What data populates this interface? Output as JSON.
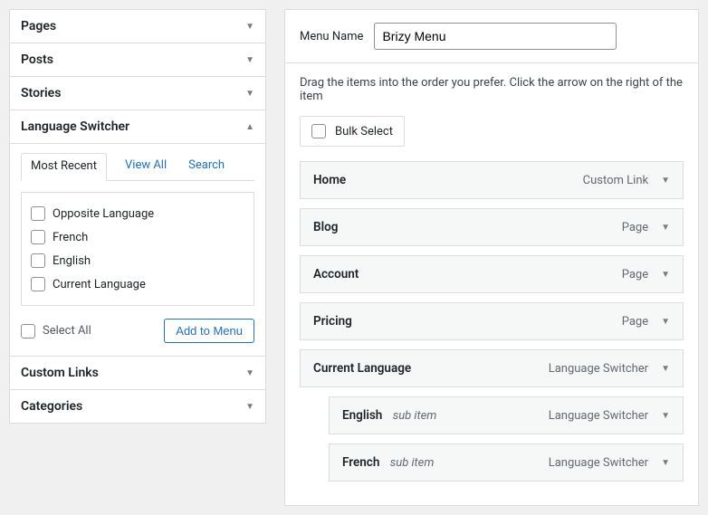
{
  "sidebar": {
    "sections": [
      {
        "title": "Pages"
      },
      {
        "title": "Posts"
      },
      {
        "title": "Stories"
      },
      {
        "title": "Language Switcher"
      },
      {
        "title": "Custom Links"
      },
      {
        "title": "Categories"
      }
    ],
    "languageSwitcher": {
      "tabs": {
        "mostRecent": "Most Recent",
        "viewAll": "View All",
        "search": "Search"
      },
      "items": [
        "Opposite Language",
        "French",
        "English",
        "Current Language"
      ],
      "selectAll": "Select All",
      "addToMenu": "Add to Menu"
    }
  },
  "main": {
    "menuNameLabel": "Menu Name",
    "menuNameValue": "Brizy Menu",
    "instruction": "Drag the items into the order you prefer. Click the arrow on the right of the item",
    "bulkSelect": "Bulk Select",
    "subItemText": "sub item",
    "menuItems": [
      {
        "title": "Home",
        "type": "Custom Link"
      },
      {
        "title": "Blog",
        "type": "Page"
      },
      {
        "title": "Account",
        "type": "Page"
      },
      {
        "title": "Pricing",
        "type": "Page"
      },
      {
        "title": "Current Language",
        "type": "Language Switcher"
      },
      {
        "title": "English",
        "type": "Language Switcher",
        "sub": true
      },
      {
        "title": "French",
        "type": "Language Switcher",
        "sub": true
      }
    ]
  }
}
